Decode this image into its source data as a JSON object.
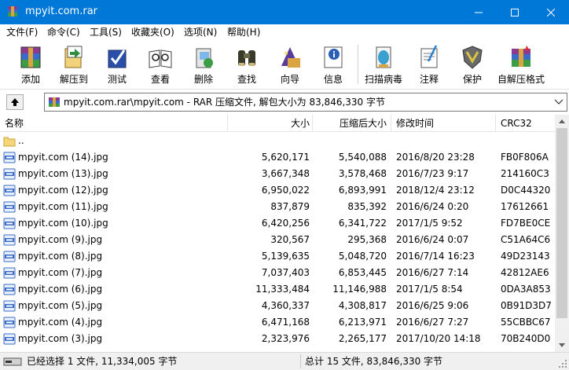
{
  "window": {
    "title": "mpyit.com.rar",
    "accent": "#0078d7"
  },
  "menu": [
    "文件(F)",
    "命令(C)",
    "工具(S)",
    "收藏夹(O)",
    "选项(N)",
    "帮助(H)"
  ],
  "toolbar": {
    "tools": [
      {
        "label": "添加",
        "icon": "add-archive-icon"
      },
      {
        "label": "解压到",
        "icon": "extract-to-icon"
      },
      {
        "label": "测试",
        "icon": "test-icon"
      },
      {
        "label": "查看",
        "icon": "view-icon"
      },
      {
        "label": "删除",
        "icon": "delete-icon"
      },
      {
        "label": "查找",
        "icon": "find-icon"
      },
      {
        "label": "向导",
        "icon": "wizard-icon"
      },
      {
        "label": "信息",
        "icon": "info-icon"
      },
      {
        "label": "扫描病毒",
        "icon": "virus-scan-icon"
      },
      {
        "label": "注释",
        "icon": "comment-icon"
      },
      {
        "label": "保护",
        "icon": "protect-icon"
      },
      {
        "label": "自解压格式",
        "icon": "sfx-icon"
      }
    ]
  },
  "address": {
    "path": "mpyit.com.rar\\mpyit.com - RAR 压缩文件, 解包大小为 83,846,330 字节"
  },
  "columns": {
    "name": "名称",
    "size": "大小",
    "packed": "压缩后大小",
    "modified": "修改时间",
    "crc": "CRC32"
  },
  "parent_row": "..",
  "files": [
    {
      "name": "mpyit.com (14).jpg",
      "size": "5,620,171",
      "packed": "5,540,088",
      "modified": "2016/8/20 23:28",
      "crc": "FB0F806A"
    },
    {
      "name": "mpyit.com (13).jpg",
      "size": "3,667,348",
      "packed": "3,578,468",
      "modified": "2016/7/23 9:17",
      "crc": "214160C3"
    },
    {
      "name": "mpyit.com (12).jpg",
      "size": "6,950,022",
      "packed": "6,893,991",
      "modified": "2018/12/4 23:12",
      "crc": "D0C44320"
    },
    {
      "name": "mpyit.com (11).jpg",
      "size": "837,879",
      "packed": "835,392",
      "modified": "2016/6/24 0:20",
      "crc": "17612661"
    },
    {
      "name": "mpyit.com (10).jpg",
      "size": "6,420,256",
      "packed": "6,341,722",
      "modified": "2017/1/5 9:52",
      "crc": "FD7BE0CE"
    },
    {
      "name": "mpyit.com (9).jpg",
      "size": "320,567",
      "packed": "295,368",
      "modified": "2016/6/24 0:07",
      "crc": "C51A64C6"
    },
    {
      "name": "mpyit.com (8).jpg",
      "size": "5,139,635",
      "packed": "5,048,720",
      "modified": "2016/7/14 16:23",
      "crc": "49D23143"
    },
    {
      "name": "mpyit.com (7).jpg",
      "size": "7,037,403",
      "packed": "6,853,445",
      "modified": "2016/6/27 7:14",
      "crc": "42812AE6"
    },
    {
      "name": "mpyit.com (6).jpg",
      "size": "11,333,484",
      "packed": "11,146,988",
      "modified": "2017/1/5 8:54",
      "crc": "0DA3A853"
    },
    {
      "name": "mpyit.com (5).jpg",
      "size": "4,360,337",
      "packed": "4,308,817",
      "modified": "2016/6/25 9:06",
      "crc": "0B91D3D7"
    },
    {
      "name": "mpyit.com (4).jpg",
      "size": "6,471,168",
      "packed": "6,213,971",
      "modified": "2016/6/27 7:27",
      "crc": "55CBBC67"
    },
    {
      "name": "mpyit.com (3).jpg",
      "size": "2,323,976",
      "packed": "2,265,177",
      "modified": "2017/10/20 14:18",
      "crc": "70B240D0"
    }
  ],
  "status": {
    "selected": "已经选择 1 文件, 11,334,005 字节",
    "total": "总计 15 文件, 83,846,330 字节"
  }
}
